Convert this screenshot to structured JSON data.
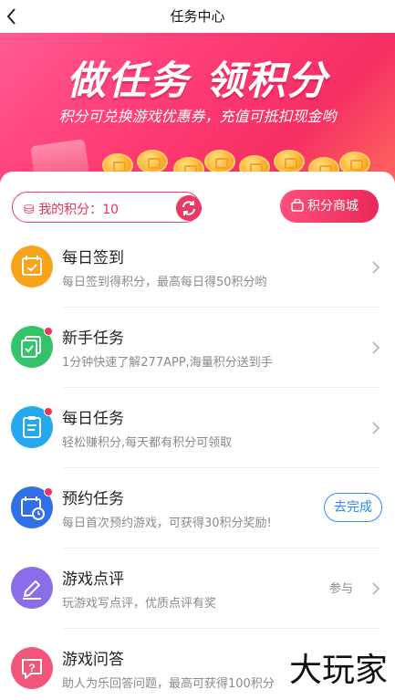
{
  "header": {
    "title": "任务中心"
  },
  "banner": {
    "headline": "做任务  领积分",
    "subline": "积分可兑换游戏优惠券，充值可抵扣现金哟"
  },
  "points": {
    "label": "我的积分：",
    "value": "10"
  },
  "mall": {
    "label": "积分商城"
  },
  "tasks": [
    {
      "title": "每日签到",
      "desc": "每日签到得积分，最高每日得50积分哟",
      "icon": "calendar-check-icon",
      "color": "#f7a41a",
      "dot": false
    },
    {
      "title": "新手任务",
      "desc": "1分钟快速了解277APP,海量积分送到手",
      "icon": "copy-check-icon",
      "color": "#33c46a",
      "dot": true
    },
    {
      "title": "每日任务",
      "desc": "轻松赚积分,每天都有积分可领取",
      "icon": "clipboard-icon",
      "color": "#25a8ee",
      "dot": true
    },
    {
      "title": "预约任务",
      "desc": "每日首次预约游戏，可获得30积分奖励!",
      "icon": "calendar-clock-icon",
      "color": "#2f6fe8",
      "dot": true,
      "action": "去完成"
    },
    {
      "title": "游戏点评",
      "desc": "玩游戏写点评，优质点评有奖",
      "icon": "pen-icon",
      "color": "#8a6de9",
      "dot": false,
      "side": "参与"
    },
    {
      "title": "游戏问答",
      "desc": "助人为乐回答问题，最高可获得100积分",
      "icon": "question-icon",
      "color": "#f2557a",
      "dot": false
    }
  ],
  "watermark": "大玩家"
}
